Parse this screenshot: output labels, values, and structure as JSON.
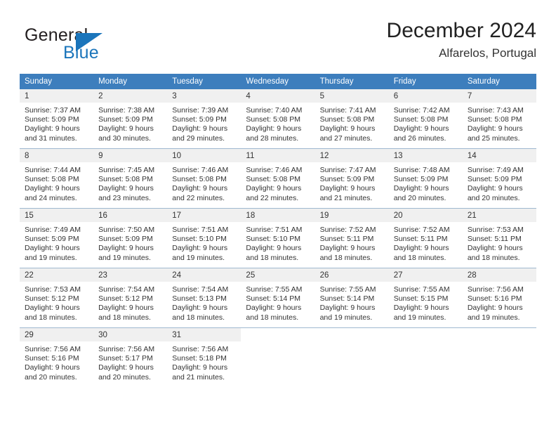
{
  "brand": {
    "line1": "General",
    "line2": "Blue",
    "accent_color": "#1b75bb",
    "triangle_icon": "brand-triangle-icon"
  },
  "header": {
    "title": "December 2024",
    "subtitle": "Alfarelos, Portugal"
  },
  "calendar": {
    "header_background": "#3d7ebd",
    "daynum_background": "#f0f0f0",
    "weekday_names": [
      "Sunday",
      "Monday",
      "Tuesday",
      "Wednesday",
      "Thursday",
      "Friday",
      "Saturday"
    ],
    "weeks": [
      [
        {
          "day": "1",
          "sunrise": "Sunrise: 7:37 AM",
          "sunset": "Sunset: 5:09 PM",
          "daylight1": "Daylight: 9 hours",
          "daylight2": "and 31 minutes."
        },
        {
          "day": "2",
          "sunrise": "Sunrise: 7:38 AM",
          "sunset": "Sunset: 5:09 PM",
          "daylight1": "Daylight: 9 hours",
          "daylight2": "and 30 minutes."
        },
        {
          "day": "3",
          "sunrise": "Sunrise: 7:39 AM",
          "sunset": "Sunset: 5:09 PM",
          "daylight1": "Daylight: 9 hours",
          "daylight2": "and 29 minutes."
        },
        {
          "day": "4",
          "sunrise": "Sunrise: 7:40 AM",
          "sunset": "Sunset: 5:08 PM",
          "daylight1": "Daylight: 9 hours",
          "daylight2": "and 28 minutes."
        },
        {
          "day": "5",
          "sunrise": "Sunrise: 7:41 AM",
          "sunset": "Sunset: 5:08 PM",
          "daylight1": "Daylight: 9 hours",
          "daylight2": "and 27 minutes."
        },
        {
          "day": "6",
          "sunrise": "Sunrise: 7:42 AM",
          "sunset": "Sunset: 5:08 PM",
          "daylight1": "Daylight: 9 hours",
          "daylight2": "and 26 minutes."
        },
        {
          "day": "7",
          "sunrise": "Sunrise: 7:43 AM",
          "sunset": "Sunset: 5:08 PM",
          "daylight1": "Daylight: 9 hours",
          "daylight2": "and 25 minutes."
        }
      ],
      [
        {
          "day": "8",
          "sunrise": "Sunrise: 7:44 AM",
          "sunset": "Sunset: 5:08 PM",
          "daylight1": "Daylight: 9 hours",
          "daylight2": "and 24 minutes."
        },
        {
          "day": "9",
          "sunrise": "Sunrise: 7:45 AM",
          "sunset": "Sunset: 5:08 PM",
          "daylight1": "Daylight: 9 hours",
          "daylight2": "and 23 minutes."
        },
        {
          "day": "10",
          "sunrise": "Sunrise: 7:46 AM",
          "sunset": "Sunset: 5:08 PM",
          "daylight1": "Daylight: 9 hours",
          "daylight2": "and 22 minutes."
        },
        {
          "day": "11",
          "sunrise": "Sunrise: 7:46 AM",
          "sunset": "Sunset: 5:08 PM",
          "daylight1": "Daylight: 9 hours",
          "daylight2": "and 22 minutes."
        },
        {
          "day": "12",
          "sunrise": "Sunrise: 7:47 AM",
          "sunset": "Sunset: 5:09 PM",
          "daylight1": "Daylight: 9 hours",
          "daylight2": "and 21 minutes."
        },
        {
          "day": "13",
          "sunrise": "Sunrise: 7:48 AM",
          "sunset": "Sunset: 5:09 PM",
          "daylight1": "Daylight: 9 hours",
          "daylight2": "and 20 minutes."
        },
        {
          "day": "14",
          "sunrise": "Sunrise: 7:49 AM",
          "sunset": "Sunset: 5:09 PM",
          "daylight1": "Daylight: 9 hours",
          "daylight2": "and 20 minutes."
        }
      ],
      [
        {
          "day": "15",
          "sunrise": "Sunrise: 7:49 AM",
          "sunset": "Sunset: 5:09 PM",
          "daylight1": "Daylight: 9 hours",
          "daylight2": "and 19 minutes."
        },
        {
          "day": "16",
          "sunrise": "Sunrise: 7:50 AM",
          "sunset": "Sunset: 5:09 PM",
          "daylight1": "Daylight: 9 hours",
          "daylight2": "and 19 minutes."
        },
        {
          "day": "17",
          "sunrise": "Sunrise: 7:51 AM",
          "sunset": "Sunset: 5:10 PM",
          "daylight1": "Daylight: 9 hours",
          "daylight2": "and 19 minutes."
        },
        {
          "day": "18",
          "sunrise": "Sunrise: 7:51 AM",
          "sunset": "Sunset: 5:10 PM",
          "daylight1": "Daylight: 9 hours",
          "daylight2": "and 18 minutes."
        },
        {
          "day": "19",
          "sunrise": "Sunrise: 7:52 AM",
          "sunset": "Sunset: 5:11 PM",
          "daylight1": "Daylight: 9 hours",
          "daylight2": "and 18 minutes."
        },
        {
          "day": "20",
          "sunrise": "Sunrise: 7:52 AM",
          "sunset": "Sunset: 5:11 PM",
          "daylight1": "Daylight: 9 hours",
          "daylight2": "and 18 minutes."
        },
        {
          "day": "21",
          "sunrise": "Sunrise: 7:53 AM",
          "sunset": "Sunset: 5:11 PM",
          "daylight1": "Daylight: 9 hours",
          "daylight2": "and 18 minutes."
        }
      ],
      [
        {
          "day": "22",
          "sunrise": "Sunrise: 7:53 AM",
          "sunset": "Sunset: 5:12 PM",
          "daylight1": "Daylight: 9 hours",
          "daylight2": "and 18 minutes."
        },
        {
          "day": "23",
          "sunrise": "Sunrise: 7:54 AM",
          "sunset": "Sunset: 5:12 PM",
          "daylight1": "Daylight: 9 hours",
          "daylight2": "and 18 minutes."
        },
        {
          "day": "24",
          "sunrise": "Sunrise: 7:54 AM",
          "sunset": "Sunset: 5:13 PM",
          "daylight1": "Daylight: 9 hours",
          "daylight2": "and 18 minutes."
        },
        {
          "day": "25",
          "sunrise": "Sunrise: 7:55 AM",
          "sunset": "Sunset: 5:14 PM",
          "daylight1": "Daylight: 9 hours",
          "daylight2": "and 18 minutes."
        },
        {
          "day": "26",
          "sunrise": "Sunrise: 7:55 AM",
          "sunset": "Sunset: 5:14 PM",
          "daylight1": "Daylight: 9 hours",
          "daylight2": "and 19 minutes."
        },
        {
          "day": "27",
          "sunrise": "Sunrise: 7:55 AM",
          "sunset": "Sunset: 5:15 PM",
          "daylight1": "Daylight: 9 hours",
          "daylight2": "and 19 minutes."
        },
        {
          "day": "28",
          "sunrise": "Sunrise: 7:56 AM",
          "sunset": "Sunset: 5:16 PM",
          "daylight1": "Daylight: 9 hours",
          "daylight2": "and 19 minutes."
        }
      ],
      [
        {
          "day": "29",
          "sunrise": "Sunrise: 7:56 AM",
          "sunset": "Sunset: 5:16 PM",
          "daylight1": "Daylight: 9 hours",
          "daylight2": "and 20 minutes."
        },
        {
          "day": "30",
          "sunrise": "Sunrise: 7:56 AM",
          "sunset": "Sunset: 5:17 PM",
          "daylight1": "Daylight: 9 hours",
          "daylight2": "and 20 minutes."
        },
        {
          "day": "31",
          "sunrise": "Sunrise: 7:56 AM",
          "sunset": "Sunset: 5:18 PM",
          "daylight1": "Daylight: 9 hours",
          "daylight2": "and 21 minutes."
        },
        {
          "day": "",
          "sunrise": "",
          "sunset": "",
          "daylight1": "",
          "daylight2": ""
        },
        {
          "day": "",
          "sunrise": "",
          "sunset": "",
          "daylight1": "",
          "daylight2": ""
        },
        {
          "day": "",
          "sunrise": "",
          "sunset": "",
          "daylight1": "",
          "daylight2": ""
        },
        {
          "day": "",
          "sunrise": "",
          "sunset": "",
          "daylight1": "",
          "daylight2": ""
        }
      ]
    ]
  }
}
